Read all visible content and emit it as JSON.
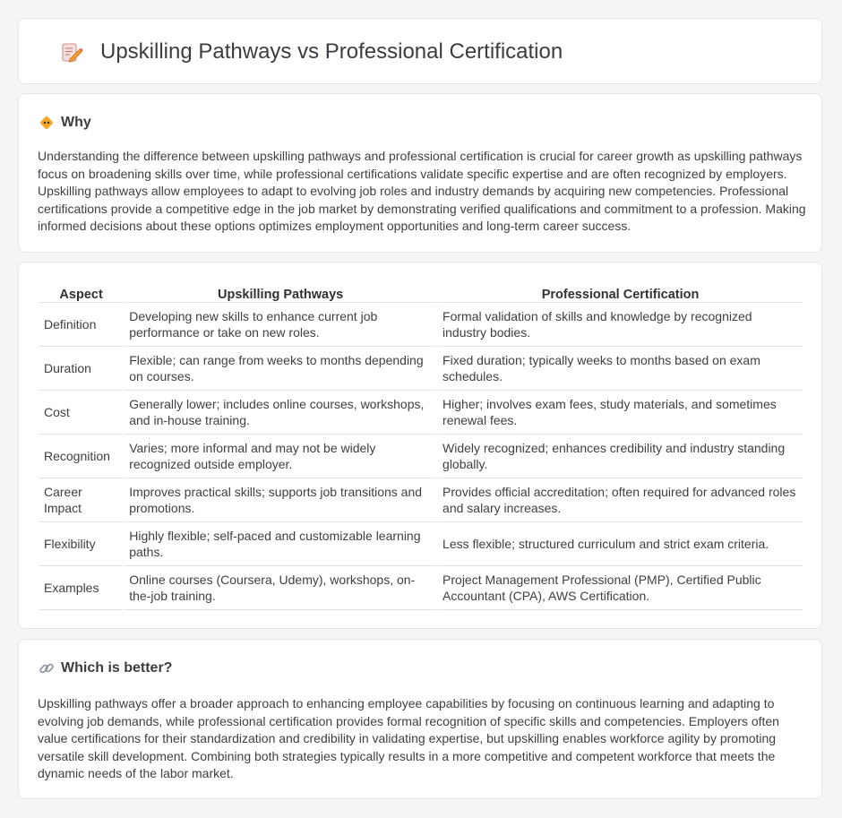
{
  "header": {
    "title": "Upskilling Pathways vs Professional Certification",
    "icon": "pencil-memo-icon"
  },
  "why": {
    "heading": "Why",
    "icon": "diamond-warning-icon",
    "text": "Understanding the difference between upskilling pathways and professional certification is crucial for career growth as upskilling pathways focus on broadening skills over time, while professional certifications validate specific expertise and are often recognized by employers. Upskilling pathways allow employees to adapt to evolving job roles and industry demands by acquiring new competencies. Professional certifications provide a competitive edge in the job market by demonstrating verified qualifications and commitment to a profession. Making informed decisions about these options optimizes employment opportunities and long-term career success."
  },
  "table": {
    "headers": [
      "Aspect",
      "Upskilling Pathways",
      "Professional Certification"
    ],
    "rows": [
      [
        "Definition",
        "Developing new skills to enhance current job performance or take on new roles.",
        "Formal validation of skills and knowledge by recognized industry bodies."
      ],
      [
        "Duration",
        "Flexible; can range from weeks to months depending on courses.",
        "Fixed duration; typically weeks to months based on exam schedules."
      ],
      [
        "Cost",
        "Generally lower; includes online courses, workshops, and in-house training.",
        "Higher; involves exam fees, study materials, and sometimes renewal fees."
      ],
      [
        "Recognition",
        "Varies; more informal and may not be widely recognized outside employer.",
        "Widely recognized; enhances credibility and industry standing globally."
      ],
      [
        "Career Impact",
        "Improves practical skills; supports job transitions and promotions.",
        "Provides official accreditation; often required for advanced roles and salary increases."
      ],
      [
        "Flexibility",
        "Highly flexible; self-paced and customizable learning paths.",
        "Less flexible; structured curriculum and strict exam criteria."
      ],
      [
        "Examples",
        "Online courses (Coursera, Udemy), workshops, on-the-job training.",
        "Project Management Professional (PMP), Certified Public Accountant (CPA), AWS Certification."
      ]
    ]
  },
  "better": {
    "heading": "Which is better?",
    "icon": "link-icon",
    "text": "Upskilling pathways offer a broader approach to enhancing employee capabilities by focusing on continuous learning and adapting to evolving job demands, while professional certification provides formal recognition of specific skills and competencies. Employers often value certifications for their standardization and credibility in validating expertise, but upskilling enables workforce agility by promoting versatile skill development. Combining both strategies typically results in a more competitive and competent workforce that meets the dynamic needs of the labor market."
  }
}
